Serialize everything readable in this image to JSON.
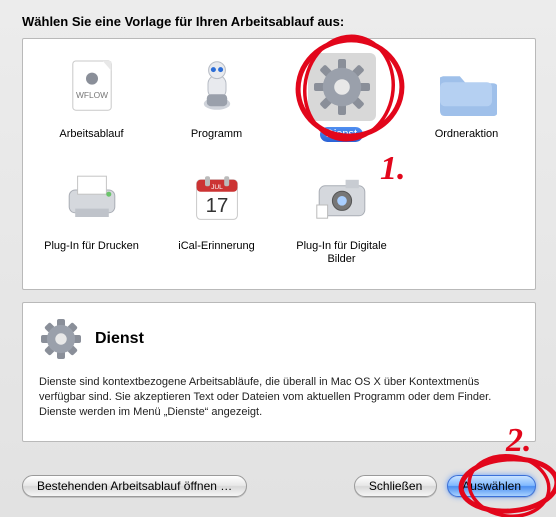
{
  "heading": "Wählen Sie eine Vorlage für Ihren Arbeitsablauf aus:",
  "items": [
    {
      "label": "Arbeitsablauf",
      "icon": "wflow",
      "selected": false
    },
    {
      "label": "Programm",
      "icon": "robot",
      "selected": false
    },
    {
      "label": "Dienst",
      "icon": "gear",
      "selected": true
    },
    {
      "label": "Ordneraktion",
      "icon": "folder",
      "selected": false
    },
    {
      "label": "Plug-In für Drucken",
      "icon": "printer",
      "selected": false
    },
    {
      "label": "iCal-Erinnerung",
      "icon": "calendar",
      "selected": false
    },
    {
      "label": "Plug-In für Digitale Bilder",
      "icon": "camera",
      "selected": false
    }
  ],
  "detail": {
    "icon": "gear",
    "title": "Dienst",
    "body": "Dienste sind kontextbezogene Arbeitsabläufe, die überall in Mac OS X über Kontextmenüs verfügbar sind. Sie akzeptieren Text oder Dateien vom aktuellen Programm oder dem Finder. Dienste werden im Menü „Dienste“ angezeigt."
  },
  "buttons": {
    "open": "Bestehenden Arbeitsablauf öffnen …",
    "close": "Schließen",
    "choose": "Auswählen"
  },
  "annotations": {
    "one": "1.",
    "two": "2."
  }
}
